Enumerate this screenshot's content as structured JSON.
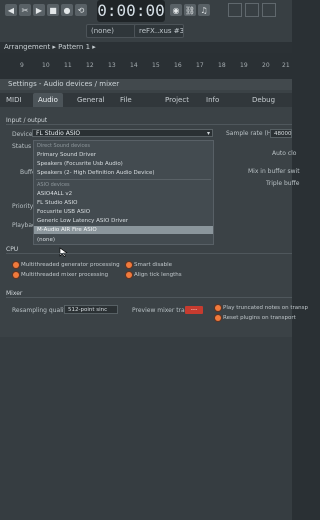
{
  "toolbar": {
    "time": "0:00:00",
    "mode_value": "(none)",
    "track_value": "reFX..xus #3",
    "icons": [
      "arrow-left-icon",
      "scissors-icon",
      "play-icon",
      "stop-icon",
      "record-icon",
      "tempo-icon",
      "record-icon",
      "link-icon",
      "headphones-icon"
    ]
  },
  "breadcrumb": {
    "path": "Arrangement ▸ Pattern 1 ▸"
  },
  "ruler": {
    "ticks": [
      "9",
      "10",
      "11",
      "12",
      "13",
      "14",
      "15",
      "16",
      "17",
      "18",
      "19",
      "20",
      "21"
    ]
  },
  "dialog": {
    "title": "Settings - Audio devices / mixer",
    "tabs": [
      "MIDI",
      "Audio",
      "General",
      "File",
      "Project",
      "Info",
      "Debug"
    ],
    "active_tab": "Audio",
    "sections": {
      "input_output": "Input / output",
      "cpu": "CPU",
      "mixer": "Mixer"
    },
    "labels": {
      "device": "Device",
      "status": "Status",
      "buffer": "Buffe",
      "priority": "Priority",
      "playback": "Playbac",
      "sample_rate": "Sample rate (Hz)",
      "sample_rate_value": "48000",
      "auto_close": "Auto clo",
      "mix_in_buffer": "Mix in buffer swit",
      "triple_buffer": "Triple buffe"
    },
    "device_value": "FL Studio ASIO",
    "dropdown": {
      "items": [
        {
          "text": "Direct Sound devices",
          "type": "header"
        },
        {
          "text": "Primary Sound Driver",
          "type": "item"
        },
        {
          "text": "Speakers (Focusrite Usb Audio)",
          "type": "item"
        },
        {
          "text": "Speakers (2- High Definition Audio Device)",
          "type": "item"
        },
        {
          "text": "ASIO devices",
          "type": "header"
        },
        {
          "text": "ASIO4ALL v2",
          "type": "item"
        },
        {
          "text": "FL Studio ASIO",
          "type": "item"
        },
        {
          "text": "Focusrite USB ASIO",
          "type": "item"
        },
        {
          "text": "Generic Low Latency ASIO Driver",
          "type": "item"
        },
        {
          "text": "M-Audio AIR Fire ASIO",
          "type": "selected"
        },
        {
          "text": "(none)",
          "type": "item"
        }
      ]
    },
    "cpu_options": {
      "multithreaded_generator": "Multithreaded generator processing",
      "smart_disable": "Smart disable",
      "multithreaded_mixer": "Multithreaded mixer processing",
      "align_tick": "Align tick lengths"
    },
    "mixer_options": {
      "resampling_label": "Resampling quality",
      "resampling_value": "512-point sinc",
      "preview_label": "Preview mixer track",
      "preview_value": "---",
      "play_truncated": "Play truncated notes on transp",
      "reset_plugins": "Reset plugins on transport"
    }
  },
  "colors": {
    "accent_orange": "#f07a3c",
    "selection": "#8b969c",
    "red_button": "#c63b2f"
  }
}
